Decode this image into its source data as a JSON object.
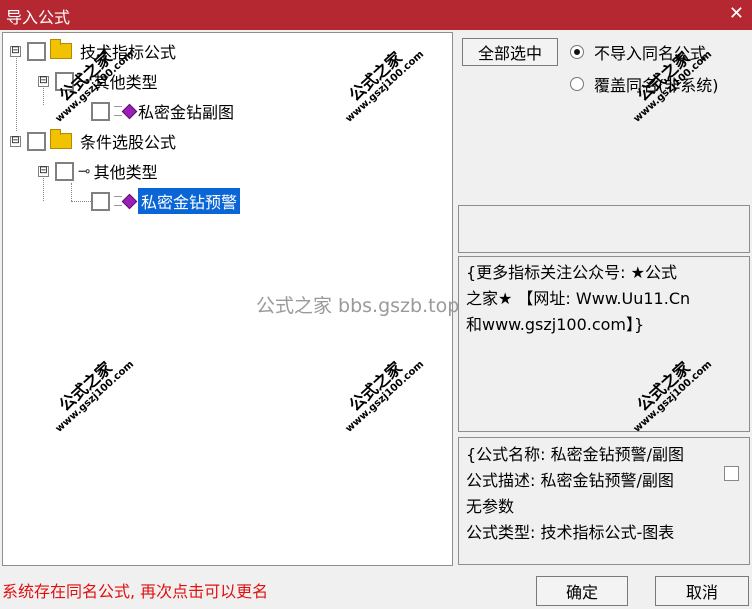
{
  "window": {
    "title": "导入公式",
    "close_glyph": "✕"
  },
  "tree": {
    "nodes": [
      {
        "label": "技术指标公式",
        "expander": "⊟"
      },
      {
        "label": "其他类型",
        "expander": "⊟"
      },
      {
        "label": "私密金钻副图"
      },
      {
        "label": "条件选股公式",
        "expander": "⊟"
      },
      {
        "label": "其他类型",
        "expander": "⊟"
      },
      {
        "label": "私密金钻预警"
      }
    ]
  },
  "options": {
    "select_all": "全部选中",
    "radio1": "不导入同名公式",
    "radio2": "覆盖同名(非系统)"
  },
  "info": {
    "lines": [
      "{更多指标关注公众号: ★公式",
      "之家★ 【网址: Www.Uu11.Cn",
      "和www.gszj100.com】}"
    ]
  },
  "desc": {
    "lines": [
      "{公式名称: 私密金钻预警/副图",
      "公式描述: 私密金钻预警/副图",
      "无参数",
      "公式类型: 技术指标公式-图表"
    ]
  },
  "status": "系统存在同名公式, 再次点击可以更名",
  "buttons": {
    "ok": "确定",
    "cancel": "取消"
  },
  "watermark": {
    "cn": "公式之家",
    "url": "www.gszj100.com",
    "center": "公式之家 bbs.gszb.top"
  },
  "colors": {
    "title_bar": "#b52831",
    "selection": "#0a66d6",
    "status_text": "#e01010"
  }
}
